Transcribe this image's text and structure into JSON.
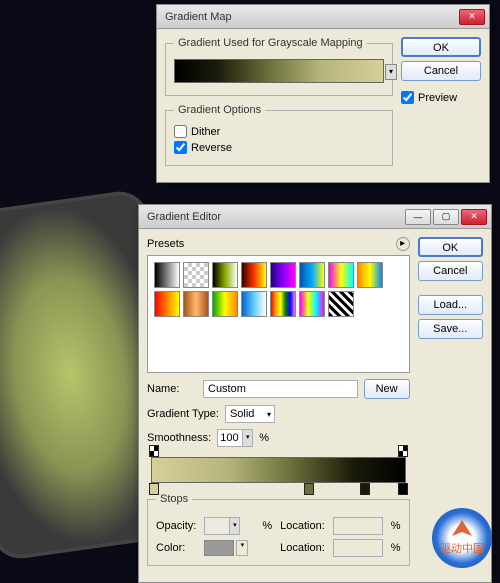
{
  "gradMap": {
    "title": "Gradient Map",
    "mappingLegend": "Gradient Used for Grayscale Mapping",
    "optionsLegend": "Gradient Options",
    "dither": "Dither",
    "reverse": "Reverse",
    "ok": "OK",
    "cancel": "Cancel",
    "preview": "Preview"
  },
  "gradEdit": {
    "title": "Gradient Editor",
    "presets": "Presets",
    "ok": "OK",
    "cancel": "Cancel",
    "load": "Load...",
    "save": "Save...",
    "nameLabel": "Name:",
    "nameValue": "Custom",
    "new": "New",
    "typeLabel": "Gradient Type:",
    "typeValue": "Solid",
    "smoothLabel": "Smoothness:",
    "smoothValue": "100",
    "pct": "%",
    "stopsLegend": "Stops",
    "opacity": "Opacity:",
    "location": "Location:",
    "color": "Color:"
  },
  "presetGradients": [
    "linear-gradient(to right,#000,#fff)",
    "repeating-conic-gradient(#ccc 0 25%,#fff 0 50%) 0/8px 8px",
    "linear-gradient(to right,#000,#8a0,#fff)",
    "linear-gradient(to right,#300,#f30,#ff0)",
    "linear-gradient(to right,#208,#80f,#f0f)",
    "linear-gradient(to right,#05a,#0af,#ff0)",
    "linear-gradient(to right,#f0f,#ff0,#0ff)",
    "linear-gradient(to right,#f80,#ff0,#08f)",
    "linear-gradient(to right,#f00,#ff0)",
    "linear-gradient(to right,#a52,#fb6,#a52)",
    "linear-gradient(to right,#0a0,#ff0,#f80)",
    "linear-gradient(to right,#06c,#6cf,#fff)",
    "linear-gradient(to right,red,orange,yellow,green,blue,violet)",
    "linear-gradient(to right,#f0f,#ff0,#0ff,#f0f)",
    "repeating-linear-gradient(45deg,#000 0 3px,#fff 3px 6px)"
  ],
  "logoText": "驱动中国"
}
